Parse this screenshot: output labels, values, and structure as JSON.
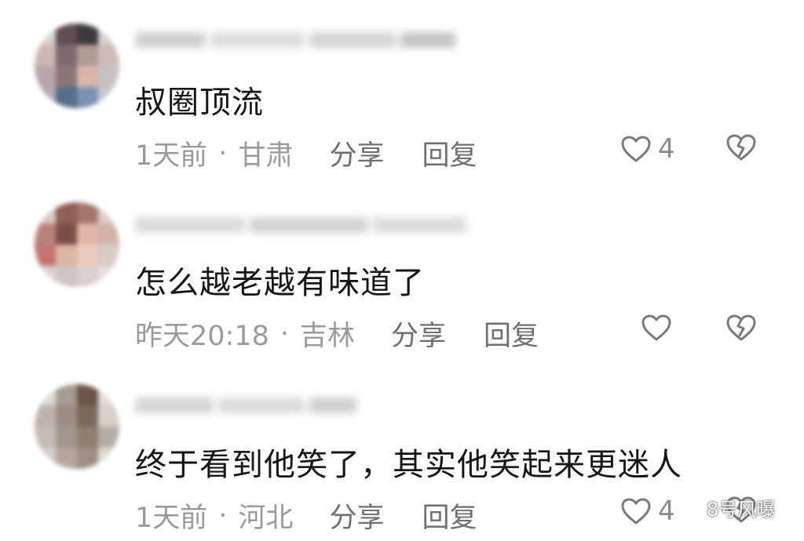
{
  "comments": [
    {
      "text": "叔圈顶流",
      "time": "1天前",
      "separator": "·",
      "location": "甘肃",
      "share_label": "分享",
      "reply_label": "回复",
      "like_count": "4"
    },
    {
      "text": "怎么越老越有味道了",
      "time": "昨天20:18",
      "separator": "·",
      "location": "吉林",
      "share_label": "分享",
      "reply_label": "回复",
      "like_count": ""
    },
    {
      "text": "终于看到他笑了，其实他笑起来更迷人",
      "time": "1天前",
      "separator": "·",
      "location": "河北",
      "share_label": "分享",
      "reply_label": "回复",
      "like_count": "4"
    }
  ],
  "watermark": {
    "text": "8号风曝"
  },
  "colors": {
    "text": "#161616",
    "meta": "#9a9a9a",
    "action": "#6f6f6f",
    "icon": "#7a7a7a"
  },
  "icons": [
    "heart-outline-icon",
    "broken-heart-icon",
    "wechat-icon"
  ]
}
